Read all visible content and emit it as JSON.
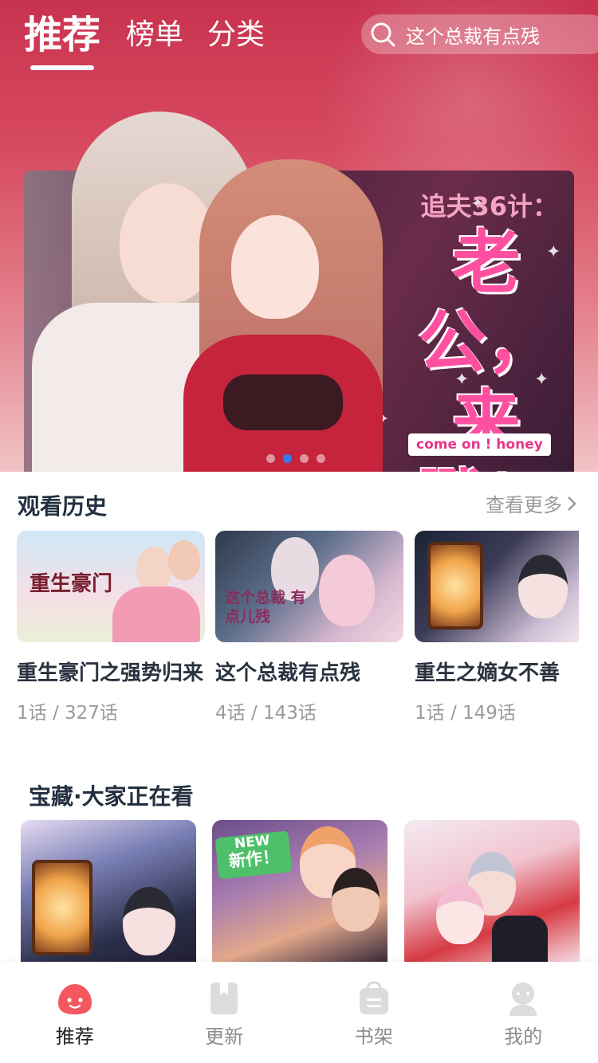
{
  "header": {
    "tabs": [
      {
        "label": "推荐",
        "active": true
      },
      {
        "label": "榜单",
        "active": false
      },
      {
        "label": "分类",
        "active": false
      }
    ],
    "search": {
      "placeholder": "这个总裁有点残",
      "icon": "search-icon"
    }
  },
  "banner": {
    "subtitle": "追夫36计：",
    "title_line1": "老公，",
    "title_line2": "来戰！",
    "tag": "come on ! honey",
    "dots_count": 4,
    "active_dot": 1
  },
  "history": {
    "title": "观看历史",
    "more": "查看更多",
    "items": [
      {
        "name": "重生豪门之强势归来",
        "progress": "1话 / 327话",
        "cover_text": "重生豪门"
      },
      {
        "name": "这个总裁有点残",
        "progress": "4话 / 143话",
        "cover_text": "这个总裁 有点儿残"
      },
      {
        "name": "重生之嫡女不善",
        "progress": "1话 / 149话",
        "cover_text": ""
      }
    ]
  },
  "treasure": {
    "title": "宝藏·大家正在看",
    "items": [
      {
        "badge": null
      },
      {
        "badge": {
          "en": "NEW",
          "zh": "新作！"
        }
      },
      {
        "badge": null
      }
    ]
  },
  "bottom_nav": [
    {
      "label": "推荐",
      "icon": "recommend-face-icon",
      "active": true,
      "color": "#f2585d"
    },
    {
      "label": "更新",
      "icon": "update-bookmark-icon",
      "active": false,
      "color": "#dcdcdc"
    },
    {
      "label": "书架",
      "icon": "bookshelf-bag-icon",
      "active": false,
      "color": "#dcdcdc"
    },
    {
      "label": "我的",
      "icon": "profile-user-icon",
      "active": false,
      "color": "#dcdcdc"
    }
  ],
  "colors": {
    "accent": "#d6485f",
    "active_dot": "#2f7cf6",
    "title_text": "#243040",
    "muted": "#9a9a9a"
  }
}
